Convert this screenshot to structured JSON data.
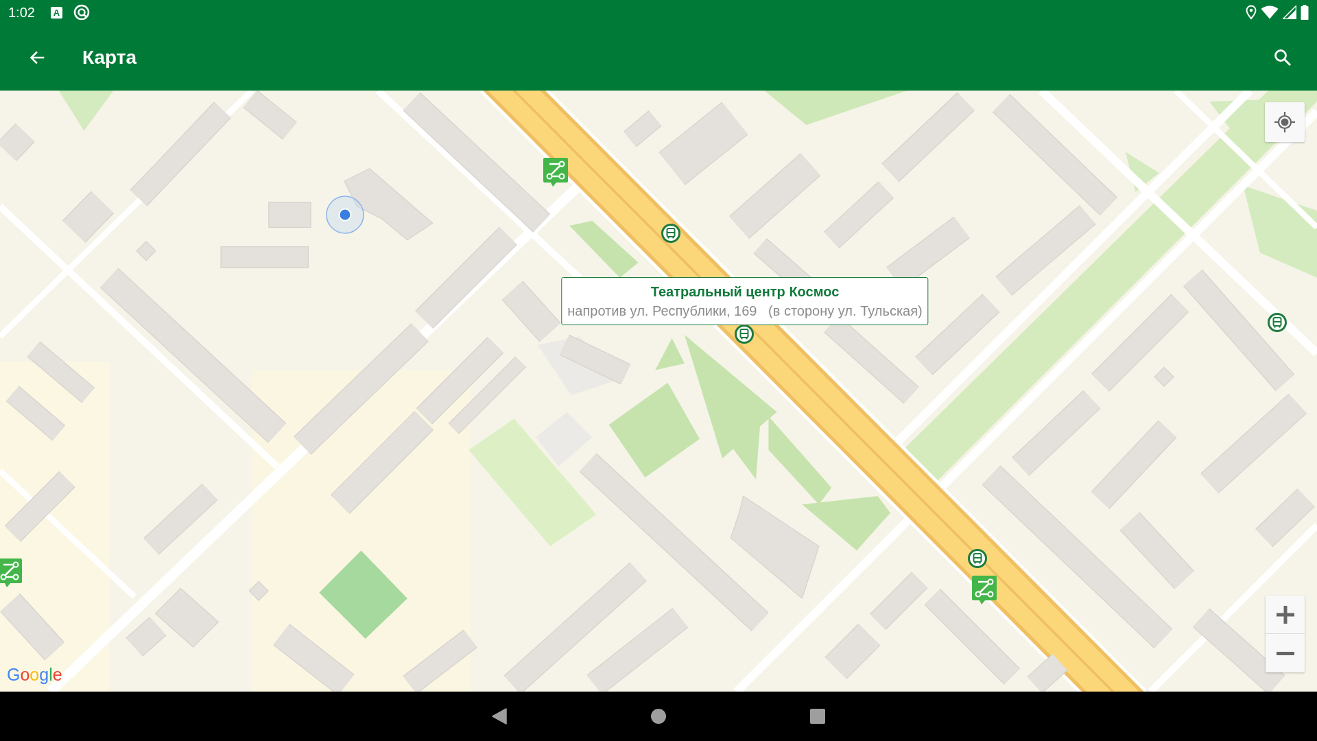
{
  "status_bar": {
    "time": "1:02",
    "notifications": [
      {
        "kind": "letter",
        "text": "A"
      },
      {
        "kind": "ring"
      }
    ]
  },
  "app_bar": {
    "title": "Карта"
  },
  "map": {
    "info_window": {
      "title": "Театральный центр Космос",
      "subtitle": "напротив ул. Республики, 169   (в сторону ул. Тульская)"
    },
    "attribution": "Google"
  }
}
